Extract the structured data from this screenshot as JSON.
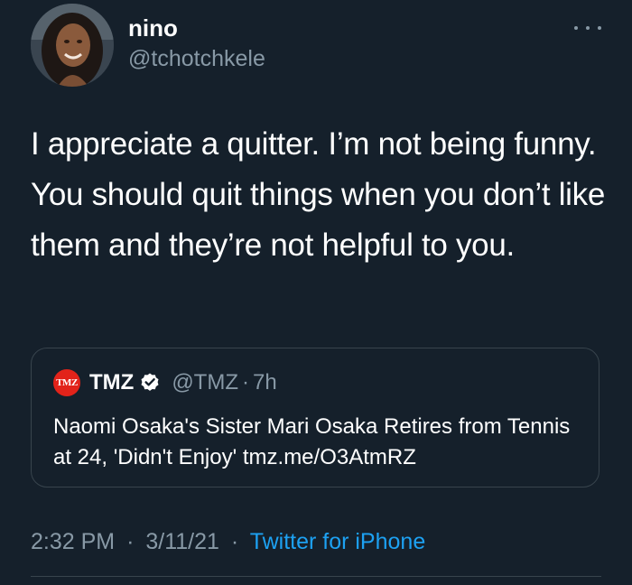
{
  "author": {
    "display_name": "nino",
    "handle": "@tchotchkele"
  },
  "tweet": {
    "text": "I appreciate a quitter. I’m not being funny. You should quit things when you don’t like them and they’re not helpful to you.",
    "time": "2:32 PM",
    "date": "3/11/21",
    "separator": "·",
    "source": "Twitter for iPhone"
  },
  "quoted_tweet": {
    "logo_text": "TMZ",
    "display_name": "TMZ",
    "handle": "@TMZ",
    "separator": "·",
    "time": "7h",
    "text": "Naomi Osaka's Sister Mari Osaka Retires from Tennis at 24, 'Didn't Enjoy' tmz.me/O3AtmRZ"
  },
  "icons": {
    "more": "more-horizontal-icon",
    "verified": "verified-badge-icon"
  },
  "colors": {
    "background": "#15202b",
    "secondary_text": "#8899a6",
    "link": "#1da1f2",
    "border": "#38444d",
    "tmz_red": "#e2231a"
  }
}
